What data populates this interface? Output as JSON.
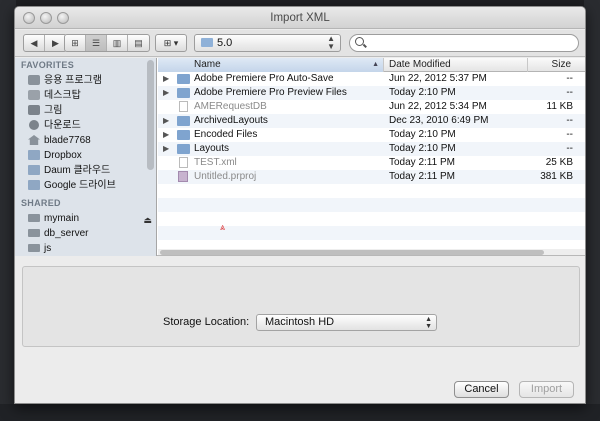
{
  "window": {
    "title": "Import XML"
  },
  "toolbar": {
    "back_icon": "chevron-left-icon",
    "forward_icon": "chevron-right-icon",
    "view_modes": [
      "icon-view",
      "list-view",
      "column-view",
      "coverflow-view"
    ],
    "arrange_icon": "grid-arrange-icon",
    "path": "5.0",
    "search_placeholder": ""
  },
  "sidebar": {
    "favorites_header": "FAVORITES",
    "favorites": [
      {
        "label": "응용 프로그램",
        "icon": "applications-icon"
      },
      {
        "label": "데스크탑",
        "icon": "desktop-icon"
      },
      {
        "label": "그림",
        "icon": "pictures-icon"
      },
      {
        "label": "다운로드",
        "icon": "downloads-icon"
      },
      {
        "label": "blade7768",
        "icon": "home-icon"
      },
      {
        "label": "Dropbox",
        "icon": "folder-icon"
      },
      {
        "label": "Daum 클라우드",
        "icon": "folder-icon"
      },
      {
        "label": "Google 드라이브",
        "icon": "folder-icon"
      }
    ],
    "shared_header": "SHARED",
    "shared": [
      {
        "label": "mymain",
        "icon": "network-monitor-icon",
        "eject": "⏏"
      },
      {
        "label": "db_server",
        "icon": "network-monitor-icon"
      },
      {
        "label": "js",
        "icon": "network-monitor-icon"
      }
    ]
  },
  "filelist": {
    "columns": {
      "name": "Name",
      "date": "Date Modified",
      "size": "Size"
    },
    "rows": [
      {
        "name": "Adobe Premiere Pro Auto-Save",
        "date": "Jun 22, 2012 5:37 PM",
        "size": "--",
        "kind": "folder",
        "dim": false
      },
      {
        "name": "Adobe Premiere Pro Preview Files",
        "date": "Today 2:10 PM",
        "size": "--",
        "kind": "folder",
        "dim": false
      },
      {
        "name": "AMERequestDB",
        "date": "Jun 22, 2012 5:34 PM",
        "size": "11 KB",
        "kind": "doc",
        "dim": "name"
      },
      {
        "name": "ArchivedLayouts",
        "date": "Dec 23, 2010 6:49 PM",
        "size": "--",
        "kind": "folder",
        "dim": false
      },
      {
        "name": "Encoded Files",
        "date": "Today 2:10 PM",
        "size": "--",
        "kind": "folder",
        "dim": false
      },
      {
        "name": "Layouts",
        "date": "Today 2:10 PM",
        "size": "--",
        "kind": "folder",
        "dim": false
      },
      {
        "name": "TEST.xml",
        "date": "Today 2:11 PM",
        "size": "25 KB",
        "kind": "doc",
        "dim": "name"
      },
      {
        "name": "Untitled.prproj",
        "date": "Today 2:11 PM",
        "size": "381 KB",
        "kind": "proj",
        "dim": "name"
      }
    ]
  },
  "accessory": {
    "storage_label": "Storage Location:",
    "storage_value": "Macintosh HD"
  },
  "buttons": {
    "cancel": "Cancel",
    "import": "Import"
  }
}
